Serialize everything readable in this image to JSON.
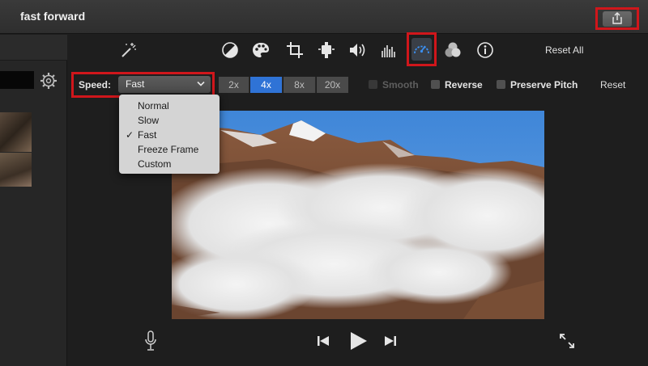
{
  "window": {
    "title": "fast forward"
  },
  "toolbar": {
    "tools": [
      {
        "name": "magic-wand-icon"
      },
      {
        "name": "color-balance-icon"
      },
      {
        "name": "color-palette-icon"
      },
      {
        "name": "crop-icon"
      },
      {
        "name": "stabilization-icon"
      },
      {
        "name": "volume-icon"
      },
      {
        "name": "equalizer-icon"
      },
      {
        "name": "speedometer-icon",
        "active": true
      },
      {
        "name": "filters-icon"
      },
      {
        "name": "info-icon"
      }
    ],
    "reset_all_label": "Reset All"
  },
  "speed": {
    "label": "Speed:",
    "selected": "Fast",
    "options": [
      "Normal",
      "Slow",
      "Fast",
      "Freeze Frame",
      "Custom"
    ],
    "checked_option": "Fast",
    "check_mark": "✓",
    "multipliers": [
      {
        "label": "2x",
        "active": false
      },
      {
        "label": "4x",
        "active": true
      },
      {
        "label": "8x",
        "active": false
      },
      {
        "label": "20x",
        "active": false
      }
    ],
    "smooth_label": "Smooth",
    "reverse_label": "Reverse",
    "preserve_pitch_label": "Preserve Pitch",
    "reset_label": "Reset"
  },
  "colors": {
    "highlight": "#d0161b",
    "accent": "#2f73d6",
    "sky": "#4d8ed6"
  }
}
